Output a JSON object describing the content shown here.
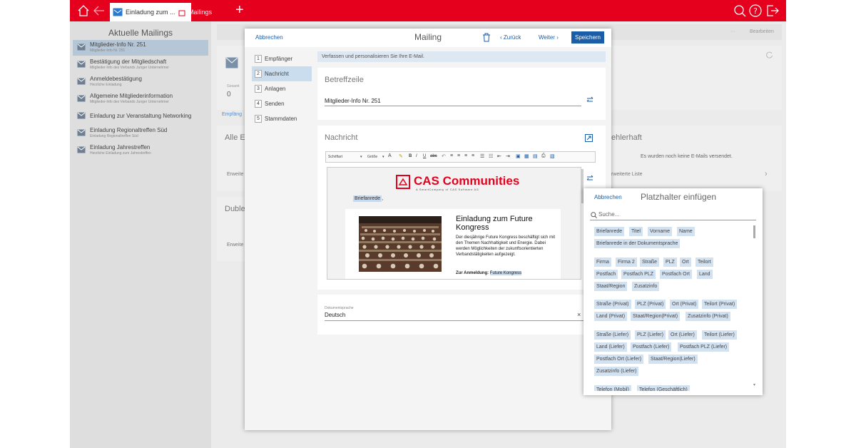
{
  "topbar": {
    "tabs": [
      {
        "label": "Einladung zum ..."
      },
      {
        "label": "Mailings"
      }
    ]
  },
  "left_list": {
    "title": "Aktuelle Mailings",
    "items": [
      {
        "title": "Mitglieder-Info Nr. 251",
        "subtitle": "Mitglieder-Info Nr. 251"
      },
      {
        "title": "Bestätigung der Mitgliedschaft",
        "subtitle": "Mitglieder-Info des Verbands Junger Unternehmer"
      },
      {
        "title": "Anmeldebestätigung",
        "subtitle": "Herzliche Einladung"
      },
      {
        "title": "Allgemeine Mitgliederinformation",
        "subtitle": "Mitglieder-Info des Verbands Junger Unternehmer"
      },
      {
        "title": "Einladung zur Veranstaltung Networking",
        "subtitle": ""
      },
      {
        "title": "Einladung Regionaltreffen Süd",
        "subtitle": "Einladung Regionaltreffen Süd"
      },
      {
        "title": "Einladung Jahrestreffen",
        "subtitle": "Herzliche Einladung zum Jahrestreffen"
      }
    ]
  },
  "background": {
    "edit": "Bearbeiten",
    "dots": "···",
    "gesamt": "Gesamt",
    "zero": "0",
    "empf_tab": "Empfäng",
    "alle": "Alle E",
    "erweite1": "Erweite",
    "duble": "Duble",
    "erweite2": "Erweite",
    "fehlerhaft": "ehlerhaft",
    "none_sent": "Es wurden noch keine E-Mails versendet.",
    "erweiterte_liste": "rweiterte Liste"
  },
  "modal": {
    "cancel": "Abbrechen",
    "title": "Mailing",
    "back": "Zurück",
    "next": "Weiter",
    "save": "Speichern",
    "steps": [
      {
        "num": "1",
        "label": "Empfänger"
      },
      {
        "num": "2",
        "label": "Nachricht"
      },
      {
        "num": "3",
        "label": "Anlagen"
      },
      {
        "num": "4",
        "label": "Senden"
      },
      {
        "num": "5",
        "label": "Stammdaten"
      }
    ],
    "info": "Verfassen und personalisieren Sie Ihre E-Mail.",
    "subject_title": "Betreffzeile",
    "subject_value": "Mitglieder-Info Nr. 251",
    "message_title": "Nachricht",
    "toolbar": {
      "font": "Schriftart",
      "size": "Größe"
    },
    "email": {
      "logo": "CAS Communities",
      "logo_sub": "A SmartCompany of CAS Software AG",
      "salutation": "Briefanrede",
      "comma": ",",
      "heading": "Einladung zum Future Kongress",
      "body": "Der diesjährige Future Kongress beschäftigt sich mit den Themen Nachhaltigkeit und Energie. Dabei werden Möglichkeiten der zukunftsorientierten Verbandstätigkeiten aufgezeigt.",
      "register_label": "Zur Anmeldung:",
      "register_link": "Future Kongress"
    },
    "doc_lang_label": "Dokumentsprache",
    "doc_lang_value": "Deutsch",
    "clear": "×"
  },
  "placeholder_panel": {
    "cancel": "Abbrechen",
    "title": "Platzhalter einfügen",
    "search_placeholder": "Suche...",
    "groups": [
      [
        "Briefanrede",
        "Titel",
        "Vorname",
        "Name",
        "Briefanrede in der Dokumentsprache"
      ],
      [
        "Firma",
        "Firma 2",
        "Straße",
        "PLZ",
        "Ort",
        "Teilort",
        "Postfach",
        "Postfach PLZ",
        "Postfach Ort",
        "Land",
        "Staat/Region",
        "Zusatzinfo"
      ],
      [
        "Straße (Privat)",
        "PLZ (Privat)",
        "Ort (Privat)",
        "Teilort (Privat)",
        "Land (Privat)",
        "Staat/Region(Privat)",
        "Zusatzinfo (Privat)"
      ],
      [
        "Straße (Liefer)",
        "PLZ (Liefer)",
        "Ort (Liefer)",
        "Teilort (Liefer)",
        "Land (Liefer)",
        "Postfach (Liefer)",
        "Postfach PLZ (Liefer)",
        "Postfach Ort (Liefer)",
        "Staat/Region(Liefer)",
        "Zusatzinfo (Liefer)"
      ],
      [
        "Telefon (Mobil)",
        "Telefon (Geschäftlich)"
      ]
    ]
  },
  "colors": {
    "brand": "#e5001e",
    "primary": "#1a5ea8",
    "chip": "#d3e2f1",
    "selected": "#c9ddef"
  }
}
